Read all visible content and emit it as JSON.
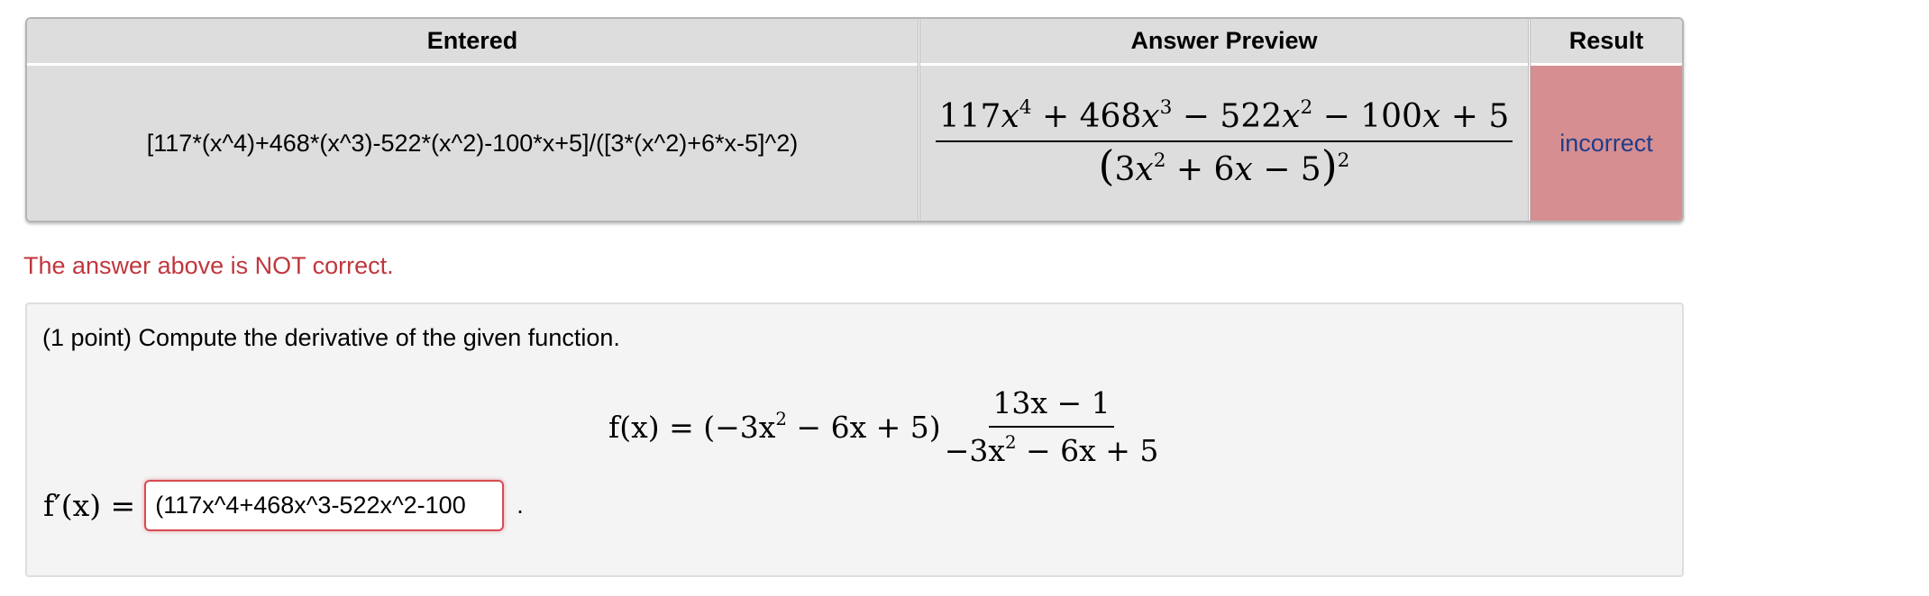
{
  "table": {
    "headers": {
      "entered": "Entered",
      "answer_preview": "Answer Preview",
      "result": "Result"
    },
    "row": {
      "entered": "[117*(x^4)+468*(x^3)-522*(x^2)-100*x+5]/([3*(x^2)+6*x-5]^2)",
      "preview": {
        "num_c1": "117",
        "num_op1": " + 468",
        "num_op2": " − 522",
        "num_op3": " − 100",
        "num_const": " + 5",
        "den_coeff": "3",
        "den_mid": " + 6",
        "den_end": " − 5",
        "exp4": "4",
        "exp3": "3",
        "exp2": "2",
        "den_outer_exp": "2",
        "var": "x"
      },
      "result": "incorrect"
    },
    "result_color": "#d68e91"
  },
  "message": {
    "text": "The answer above is NOT correct.",
    "color": "#c0373e"
  },
  "problem": {
    "prompt": "(1 point) Compute the derivative of the given function.",
    "function": {
      "lhs": "f(x) = (−3x",
      "sq": "2",
      "lhs_rest": " − 6x + 5)",
      "frac_num": "13x − 1",
      "frac_den_a": "−3x",
      "frac_den_sq": "2",
      "frac_den_b": " − 6x + 5"
    },
    "answer": {
      "lhs": "f′(x) =",
      "value": "(117x^4+468x^3-522x^2-100",
      "trailing": "."
    }
  }
}
